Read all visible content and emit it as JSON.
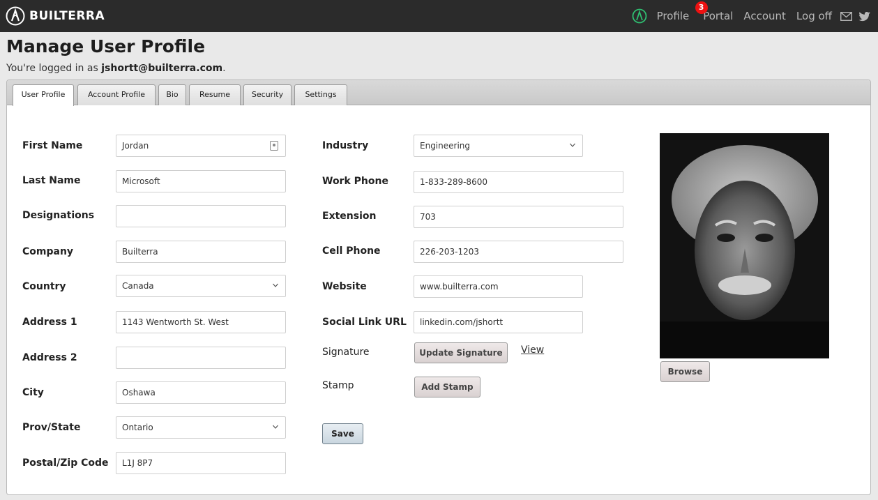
{
  "brand": {
    "name": "BUILTERRA"
  },
  "nav": {
    "profile": "Profile",
    "profile_badge": "3",
    "portal": "Portal",
    "account": "Account",
    "logoff": "Log off",
    "icons": [
      "builterra-logo-icon",
      "mail-icon",
      "twitter-icon"
    ]
  },
  "page": {
    "title": "Manage User Profile",
    "logged_prefix": "You're logged in as ",
    "logged_user": "jshortt@builterra.com",
    "logged_suffix": "."
  },
  "tabs": [
    "User Profile",
    "Account Profile",
    "Bio",
    "Resume",
    "Security",
    "Settings"
  ],
  "active_tab": "User Profile",
  "form_left": {
    "first_name": {
      "label": "First Name",
      "value": "Jordan"
    },
    "last_name": {
      "label": "Last Name",
      "value": "Microsoft"
    },
    "designations": {
      "label": "Designations",
      "value": ""
    },
    "company": {
      "label": "Company",
      "value": "Builterra"
    },
    "country": {
      "label": "Country",
      "value": "Canada"
    },
    "address1": {
      "label": "Address 1",
      "value": "1143 Wentworth St. West"
    },
    "address2": {
      "label": "Address 2",
      "value": ""
    },
    "city": {
      "label": "City",
      "value": "Oshawa"
    },
    "prov": {
      "label": "Prov/State",
      "value": "Ontario"
    },
    "postal": {
      "label": "Postal/Zip Code",
      "value": "L1J 8P7"
    }
  },
  "form_right": {
    "industry": {
      "label": "Industry",
      "value": "Engineering"
    },
    "work_phone": {
      "label": "Work Phone",
      "value": "1-833-289-8600"
    },
    "extension": {
      "label": "Extension",
      "value": "703"
    },
    "cell_phone": {
      "label": "Cell Phone",
      "value": "226-203-1203"
    },
    "website": {
      "label": "Website",
      "value": "www.builterra.com"
    },
    "social": {
      "label": "Social Link URL",
      "value": "linkedin.com/jshortt"
    },
    "signature": {
      "label": "Signature",
      "button": "Update Signature",
      "link": "View"
    },
    "stamp": {
      "label": "Stamp",
      "button": "Add Stamp"
    },
    "save": "Save"
  },
  "photo": {
    "button": "Browse"
  },
  "colors": {
    "topbar": "#2b2b2b",
    "badge": "#e11111",
    "brand_green": "#2fbf71"
  }
}
